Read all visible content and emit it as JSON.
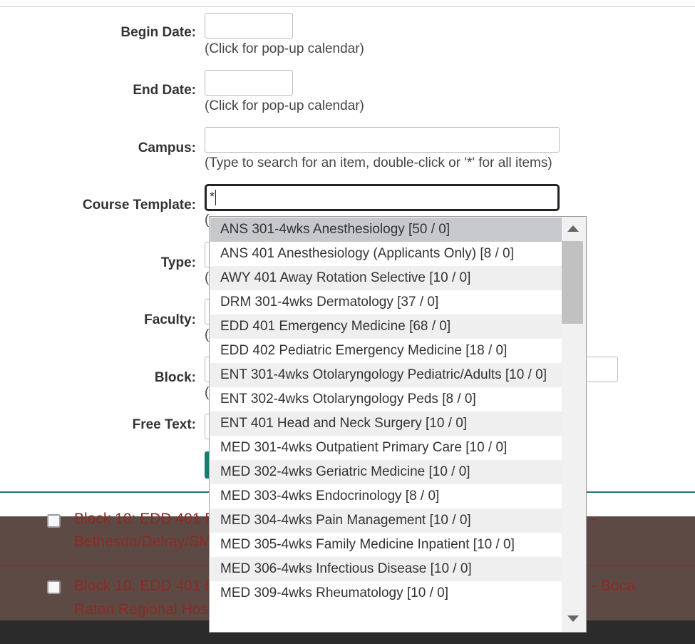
{
  "form": {
    "begin_date": {
      "label": "Begin Date:",
      "value": "",
      "hint": "(Click for pop-up calendar)"
    },
    "end_date": {
      "label": "End Date:",
      "value": "",
      "hint": "(Click for pop-up calendar)"
    },
    "campus": {
      "label": "Campus:",
      "value": "",
      "hint": "(Type to search for an item, double-click or '*' for all items)"
    },
    "course_template": {
      "label": "Course Template:",
      "value": "*",
      "hint": "("
    },
    "type": {
      "label": "Type:",
      "hint": "("
    },
    "faculty": {
      "label": "Faculty:",
      "hint": "("
    },
    "block": {
      "label": "Block:",
      "hint": "("
    },
    "free_text": {
      "label": "Free Text:"
    }
  },
  "results": [
    {
      "line1": "Block 10: EDD 401 E",
      "line1_right": "-",
      "line2": "Bethesda/Delray/SM"
    },
    {
      "line1": "Block 10: EDD 401 E",
      "line1_right": "- Boca",
      "line2": "Raton Regional Hos"
    }
  ],
  "dropdown": {
    "items": [
      "ANS 301-4wks Anesthesiology [50 / 0]",
      "ANS 401 Anesthesiology (Applicants Only) [8 / 0]",
      "AWY 401 Away Rotation Selective [10 / 0]",
      "DRM 301-4wks Dermatology [37 / 0]",
      "EDD 401 Emergency Medicine [68 / 0]",
      "EDD 402 Pediatric Emergency Medicine [18 / 0]",
      "ENT 301-4wks Otolaryngology Pediatric/Adults [10 / 0]",
      "ENT 302-4wks Otolaryngology Peds [8 / 0]",
      "ENT 401 Head and Neck Surgery [10 / 0]",
      "MED 301-4wks Outpatient Primary Care [10 / 0]",
      "MED 302-4wks Geriatric Medicine [10 / 0]",
      "MED 303-4wks Endocrinology [8 / 0]",
      "MED 304-4wks Pain Management [10 / 0]",
      "MED 305-4wks Family Medicine Inpatient [10 / 0]",
      "MED 306-4wks Infectious Disease [10 / 0]",
      "MED 309-4wks Rheumatology [10 / 0]"
    ]
  },
  "colors": {
    "accent": "#1b7b72",
    "result_text": "#8a2a24",
    "result_bg": "#5d4a45"
  }
}
